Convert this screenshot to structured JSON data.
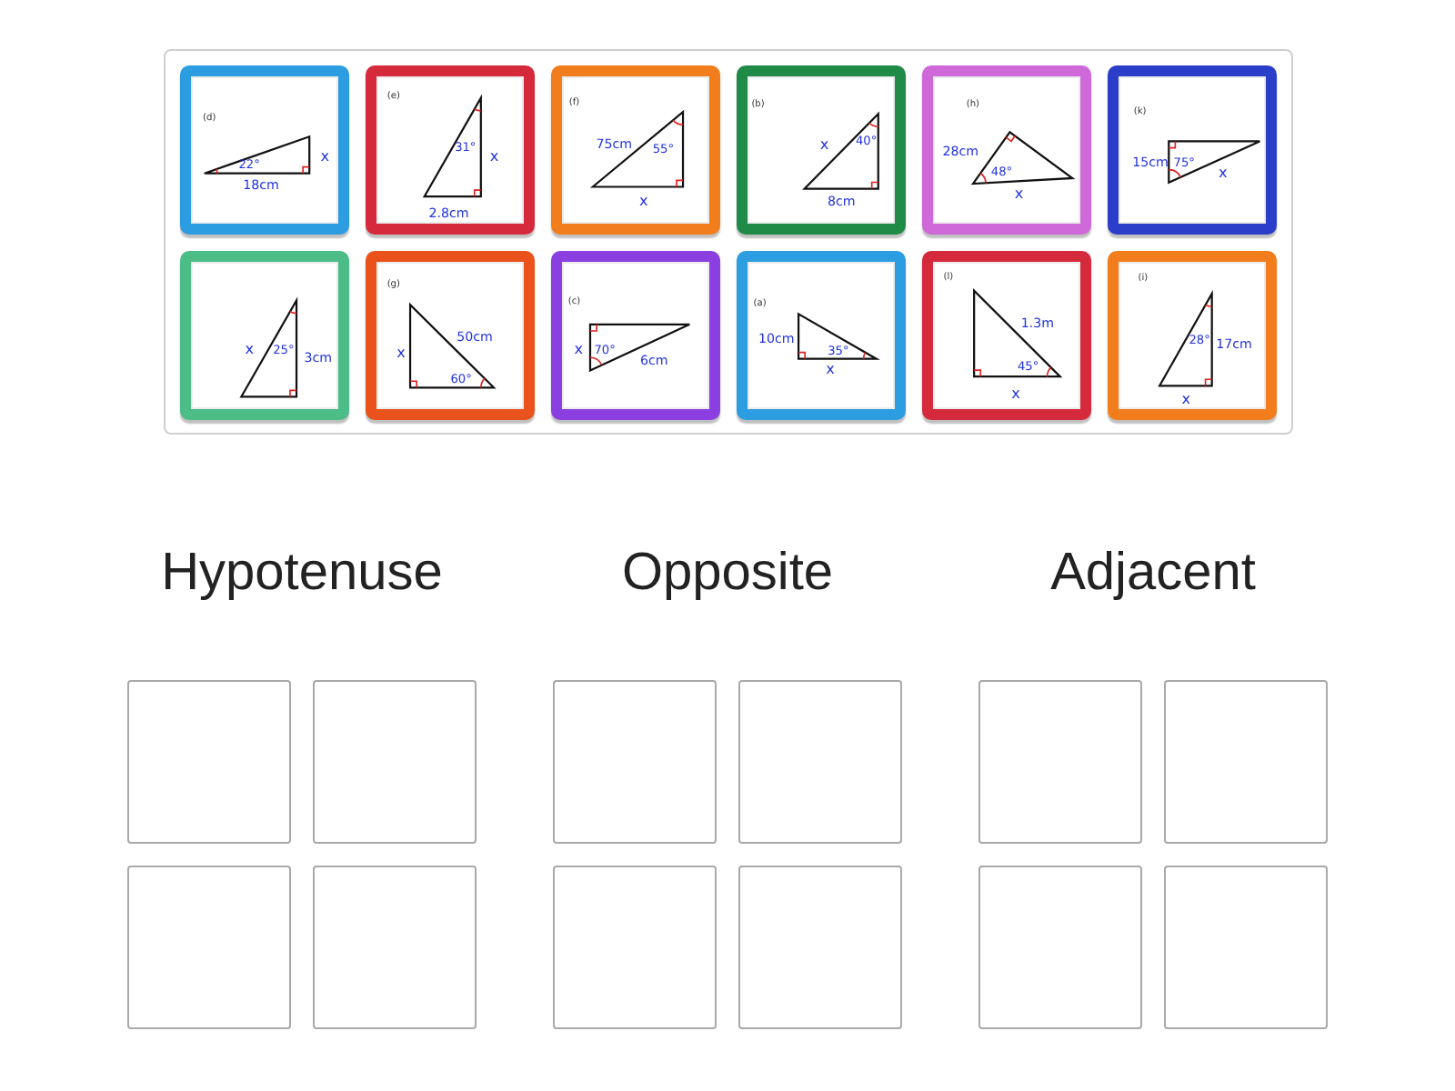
{
  "board": {
    "cards": [
      {
        "color": "#2d9de2",
        "labels": [
          {
            "kind": "tag",
            "text": "(d)"
          },
          {
            "kind": "angle",
            "text": "22°"
          },
          {
            "kind": "side",
            "text": "18cm"
          },
          {
            "kind": "unknown",
            "text": "x"
          }
        ]
      },
      {
        "color": "#d42a3c",
        "labels": [
          {
            "kind": "tag",
            "text": "(e)"
          },
          {
            "kind": "angle",
            "text": "31°"
          },
          {
            "kind": "unknown",
            "text": "x"
          },
          {
            "kind": "side",
            "text": "2.8cm"
          }
        ]
      },
      {
        "color": "#f27d1c",
        "labels": [
          {
            "kind": "tag",
            "text": "(f)"
          },
          {
            "kind": "side",
            "text": "75cm"
          },
          {
            "kind": "angle",
            "text": "55°"
          },
          {
            "kind": "unknown",
            "text": "x"
          }
        ]
      },
      {
        "color": "#1f8b47",
        "labels": [
          {
            "kind": "tag",
            "text": "(b)"
          },
          {
            "kind": "unknown",
            "text": "x"
          },
          {
            "kind": "angle",
            "text": "40°"
          },
          {
            "kind": "side",
            "text": "8cm"
          }
        ]
      },
      {
        "color": "#cf68d8",
        "labels": [
          {
            "kind": "tag",
            "text": "(h)"
          },
          {
            "kind": "side",
            "text": "28cm"
          },
          {
            "kind": "angle",
            "text": "48°"
          },
          {
            "kind": "unknown",
            "text": "x"
          }
        ]
      },
      {
        "color": "#2b3ec9",
        "labels": [
          {
            "kind": "tag",
            "text": "(k)"
          },
          {
            "kind": "side",
            "text": "15cm"
          },
          {
            "kind": "angle",
            "text": "75°"
          },
          {
            "kind": "unknown",
            "text": "x"
          }
        ]
      },
      {
        "color": "#4dbd88",
        "labels": [
          {
            "kind": "unknown",
            "text": "x"
          },
          {
            "kind": "angle",
            "text": "25°"
          },
          {
            "kind": "side",
            "text": "3cm"
          }
        ]
      },
      {
        "color": "#e9531b",
        "labels": [
          {
            "kind": "tag",
            "text": "(g)"
          },
          {
            "kind": "unknown",
            "text": "x"
          },
          {
            "kind": "side",
            "text": "50cm"
          },
          {
            "kind": "angle",
            "text": "60°"
          }
        ]
      },
      {
        "color": "#8b3fe0",
        "labels": [
          {
            "kind": "tag",
            "text": "(c)"
          },
          {
            "kind": "unknown",
            "text": "x"
          },
          {
            "kind": "angle",
            "text": "70°"
          },
          {
            "kind": "side",
            "text": "6cm"
          }
        ]
      },
      {
        "color": "#2d9de2",
        "labels": [
          {
            "kind": "tag",
            "text": "(a)"
          },
          {
            "kind": "side",
            "text": "10cm"
          },
          {
            "kind": "angle",
            "text": "35°"
          },
          {
            "kind": "unknown",
            "text": "x"
          }
        ]
      },
      {
        "color": "#d42a3c",
        "labels": [
          {
            "kind": "tag",
            "text": "(l)"
          },
          {
            "kind": "side",
            "text": "1.3m"
          },
          {
            "kind": "angle",
            "text": "45°"
          },
          {
            "kind": "unknown",
            "text": "x"
          }
        ]
      },
      {
        "color": "#f27d1c",
        "labels": [
          {
            "kind": "tag",
            "text": "(i)"
          },
          {
            "kind": "angle",
            "text": "28°"
          },
          {
            "kind": "side",
            "text": "17cm"
          },
          {
            "kind": "unknown",
            "text": "x"
          }
        ]
      }
    ]
  },
  "categories": [
    {
      "title": "Hypotenuse"
    },
    {
      "title": "Opposite"
    },
    {
      "title": "Adjacent"
    }
  ]
}
